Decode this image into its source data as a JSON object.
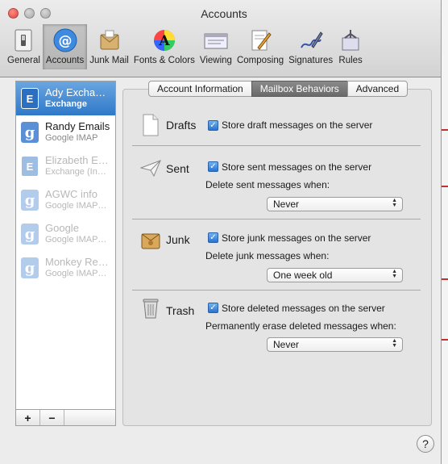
{
  "window": {
    "title": "Accounts"
  },
  "toolbar": [
    {
      "label": "General",
      "icon": "switch-icon"
    },
    {
      "label": "Accounts",
      "icon": "at-icon"
    },
    {
      "label": "Junk Mail",
      "icon": "junk-mail-icon"
    },
    {
      "label": "Fonts & Colors",
      "icon": "color-wheel-icon"
    },
    {
      "label": "Viewing",
      "icon": "viewing-icon"
    },
    {
      "label": "Composing",
      "icon": "composing-icon"
    },
    {
      "label": "Signatures",
      "icon": "signatures-icon"
    },
    {
      "label": "Rules",
      "icon": "rules-icon"
    }
  ],
  "sidebar": {
    "accounts": [
      {
        "name": "Ady Excha…",
        "type": "Exchange",
        "selected": true
      },
      {
        "name": "Randy Emails",
        "type": "Google IMAP"
      },
      {
        "name": "Elizabeth E…",
        "type": "Exchange (In…"
      },
      {
        "name": "AGWC info",
        "type": "Google IMAP…"
      },
      {
        "name": "Google",
        "type": "Google IMAP…"
      },
      {
        "name": "Monkey Re…",
        "type": "Google IMAP…"
      }
    ],
    "add_label": "+",
    "remove_label": "−"
  },
  "tabs": {
    "account_information": "Account Information",
    "mailbox_behaviors": "Mailbox Behaviors",
    "advanced": "Advanced"
  },
  "drafts": {
    "label": "Drafts",
    "store_label": "Store draft messages on the server"
  },
  "sent": {
    "label": "Sent",
    "store_label": "Store sent messages on the server",
    "delete_label": "Delete sent messages when:",
    "delete_value": "Never"
  },
  "junk": {
    "label": "Junk",
    "store_label": "Store junk messages on the server",
    "delete_label": "Delete junk messages when:",
    "delete_value": "One week old"
  },
  "trash": {
    "label": "Trash",
    "store_label": "Store deleted messages on the server",
    "erase_label": "Permanently erase deleted messages when:",
    "erase_value": "Never"
  },
  "help": {
    "label": "?"
  },
  "checkmark": "✓"
}
